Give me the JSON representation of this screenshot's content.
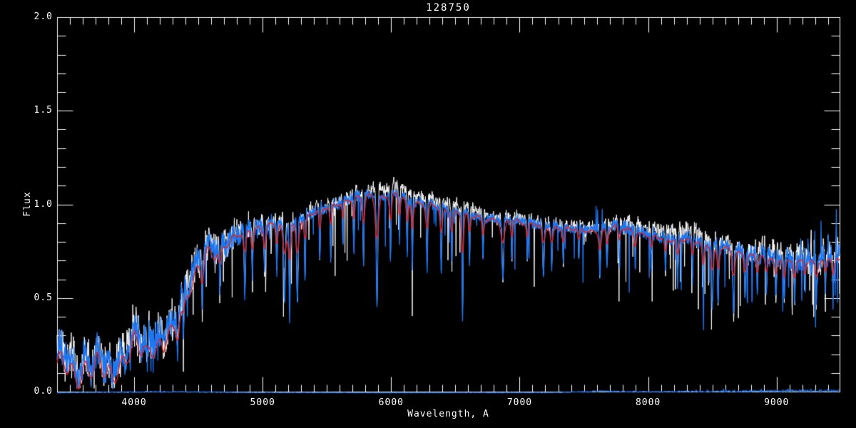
{
  "page": {
    "background": "#000000"
  },
  "chart_data": {
    "type": "line",
    "title": "128750",
    "xlabel": "Wavelength, A",
    "ylabel": "Flux",
    "xlim": [
      3400,
      9490
    ],
    "ylim": [
      0.0,
      2.0
    ],
    "grid": false,
    "legend": null,
    "background": "#000000",
    "axis_color": "#ffffff",
    "x_major_ticks": [
      {
        "value": 4000,
        "label": "4000"
      },
      {
        "value": 5000,
        "label": "5000"
      },
      {
        "value": 6000,
        "label": "6000"
      },
      {
        "value": 7000,
        "label": "7000"
      },
      {
        "value": 8000,
        "label": "8000"
      },
      {
        "value": 9000,
        "label": "9000"
      }
    ],
    "x_minor_step": 100,
    "y_major_ticks": [
      {
        "value": 0.0,
        "label": "0.0"
      },
      {
        "value": 0.5,
        "label": "0.5"
      },
      {
        "value": 1.0,
        "label": "1.0"
      },
      {
        "value": 1.5,
        "label": "1.5"
      },
      {
        "value": 2.0,
        "label": "2.0"
      }
    ],
    "y_minor_step": 0.1,
    "series": [
      {
        "name": "observed-spectrum-white",
        "color": "#ffffff",
        "role": "noisy observed spectrum drawn behind"
      },
      {
        "name": "observed-spectrum-blue",
        "color": "#1d76f2",
        "role": "noisy observed spectrum drawn on top"
      },
      {
        "name": "model-fit-red",
        "color": "#e62222",
        "role": "smooth model spectrum overlay"
      },
      {
        "name": "error-spectrum-blue",
        "color": "#1d76f2",
        "role": "near-zero error array along bottom axis"
      }
    ],
    "continuum_points": [
      [
        3400,
        0.17
      ],
      [
        3460,
        0.2
      ],
      [
        3520,
        0.16
      ],
      [
        3560,
        0.13
      ],
      [
        3620,
        0.17
      ],
      [
        3680,
        0.13
      ],
      [
        3730,
        0.19
      ],
      [
        3780,
        0.14
      ],
      [
        3840,
        0.17
      ],
      [
        3900,
        0.2
      ],
      [
        3950,
        0.28
      ],
      [
        4000,
        0.32
      ],
      [
        4060,
        0.28
      ],
      [
        4120,
        0.32
      ],
      [
        4180,
        0.28
      ],
      [
        4240,
        0.33
      ],
      [
        4300,
        0.32
      ],
      [
        4360,
        0.48
      ],
      [
        4420,
        0.6
      ],
      [
        4470,
        0.66
      ],
      [
        4520,
        0.71
      ],
      [
        4570,
        0.76
      ],
      [
        4620,
        0.74
      ],
      [
        4670,
        0.78
      ],
      [
        4720,
        0.81
      ],
      [
        4800,
        0.84
      ],
      [
        4900,
        0.86
      ],
      [
        5000,
        0.88
      ],
      [
        5100,
        0.9
      ],
      [
        5180,
        0.87
      ],
      [
        5250,
        0.9
      ],
      [
        5350,
        0.94
      ],
      [
        5450,
        0.97
      ],
      [
        5550,
        1.0
      ],
      [
        5650,
        1.02
      ],
      [
        5750,
        1.04
      ],
      [
        5850,
        1.05
      ],
      [
        5950,
        1.04
      ],
      [
        6050,
        1.05
      ],
      [
        6150,
        1.02
      ],
      [
        6250,
        1.0
      ],
      [
        6350,
        0.99
      ],
      [
        6450,
        0.97
      ],
      [
        6550,
        0.95
      ],
      [
        6650,
        0.94
      ],
      [
        6750,
        0.93
      ],
      [
        6850,
        0.91
      ],
      [
        6950,
        0.92
      ],
      [
        7050,
        0.91
      ],
      [
        7150,
        0.89
      ],
      [
        7250,
        0.88
      ],
      [
        7350,
        0.88
      ],
      [
        7450,
        0.87
      ],
      [
        7550,
        0.86
      ],
      [
        7650,
        0.87
      ],
      [
        7750,
        0.88
      ],
      [
        7850,
        0.87
      ],
      [
        7950,
        0.85
      ],
      [
        8050,
        0.83
      ],
      [
        8150,
        0.82
      ],
      [
        8250,
        0.82
      ],
      [
        8350,
        0.81
      ],
      [
        8450,
        0.8
      ],
      [
        8550,
        0.78
      ],
      [
        8650,
        0.76
      ],
      [
        8750,
        0.74
      ],
      [
        8850,
        0.73
      ],
      [
        8950,
        0.72
      ],
      [
        9050,
        0.71
      ],
      [
        9150,
        0.7
      ],
      [
        9250,
        0.7
      ],
      [
        9350,
        0.71
      ],
      [
        9430,
        0.72
      ],
      [
        9490,
        0.7
      ]
    ],
    "band_wiggle_amp_points": [
      [
        3400,
        0.085
      ],
      [
        4300,
        0.075
      ],
      [
        4700,
        0.03
      ],
      [
        5200,
        0.016
      ],
      [
        9490,
        0.012
      ]
    ],
    "absorption_lines": [
      [
        3830,
        7,
        0.45
      ],
      [
        3933,
        7,
        0.5
      ],
      [
        3968,
        7,
        0.45
      ],
      [
        4101,
        7,
        0.45
      ],
      [
        4226,
        6,
        0.45
      ],
      [
        4340,
        7,
        0.5
      ],
      [
        4383,
        6,
        0.45
      ],
      [
        4530,
        6,
        0.38
      ],
      [
        4668,
        6,
        0.32
      ],
      [
        4861,
        7,
        0.4
      ],
      [
        4920,
        5,
        0.3
      ],
      [
        5015,
        5,
        0.3
      ],
      [
        5110,
        5,
        0.32
      ],
      [
        5170,
        8,
        0.45
      ],
      [
        5210,
        6,
        0.55
      ],
      [
        5270,
        7,
        0.48
      ],
      [
        5330,
        5,
        0.35
      ],
      [
        5445,
        5,
        0.3
      ],
      [
        5530,
        5,
        0.28
      ],
      [
        5625,
        4,
        0.25
      ],
      [
        5710,
        5,
        0.3
      ],
      [
        5785,
        5,
        0.35
      ],
      [
        5890,
        8,
        0.55
      ],
      [
        5995,
        5,
        0.35
      ],
      [
        6065,
        4,
        0.25
      ],
      [
        6125,
        5,
        0.3
      ],
      [
        6165,
        5,
        0.35
      ],
      [
        6280,
        6,
        0.35
      ],
      [
        6390,
        6,
        0.35
      ],
      [
        6472,
        5,
        0.3
      ],
      [
        6556,
        5,
        0.58
      ],
      [
        6610,
        5,
        0.3
      ],
      [
        6715,
        5,
        0.25
      ],
      [
        6870,
        9,
        0.35
      ],
      [
        6940,
        5,
        0.25
      ],
      [
        7060,
        5,
        0.22
      ],
      [
        7185,
        8,
        0.3
      ],
      [
        7250,
        6,
        0.25
      ],
      [
        7340,
        5,
        0.22
      ],
      [
        7460,
        5,
        0.2
      ],
      [
        7625,
        6,
        0.3
      ],
      [
        7680,
        5,
        0.25
      ],
      [
        7775,
        5,
        0.2
      ],
      [
        7900,
        5,
        0.22
      ],
      [
        8025,
        5,
        0.22
      ],
      [
        8135,
        5,
        0.25
      ],
      [
        8230,
        6,
        0.3
      ],
      [
        8345,
        5,
        0.28
      ],
      [
        8430,
        6,
        0.4
      ],
      [
        8500,
        7,
        0.45
      ],
      [
        8545,
        6,
        0.4
      ],
      [
        8665,
        7,
        0.45
      ],
      [
        8755,
        6,
        0.32
      ],
      [
        8850,
        5,
        0.3
      ],
      [
        8920,
        6,
        0.32
      ],
      [
        8995,
        6,
        0.35
      ],
      [
        9060,
        5,
        0.32
      ],
      [
        9140,
        6,
        0.32
      ],
      [
        9220,
        5,
        0.28
      ],
      [
        9310,
        6,
        0.32
      ],
      [
        9380,
        5,
        0.28
      ],
      [
        9440,
        5,
        0.32
      ]
    ],
    "emission_spikes": [
      [
        7594,
        3,
        1.13
      ],
      [
        7607,
        6,
        0.99
      ],
      [
        7643,
        5,
        0.96
      ],
      [
        9345,
        4,
        0.92
      ],
      [
        9465,
        4,
        0.97
      ]
    ],
    "noise_amp_points": [
      [
        3400,
        0.105
      ],
      [
        3950,
        0.115
      ],
      [
        4300,
        0.12
      ],
      [
        4700,
        0.085
      ],
      [
        5100,
        0.06
      ],
      [
        5500,
        0.042
      ],
      [
        6600,
        0.035
      ],
      [
        7500,
        0.035
      ],
      [
        7900,
        0.045
      ],
      [
        8700,
        0.052
      ],
      [
        9100,
        0.08
      ],
      [
        9490,
        0.09
      ]
    ],
    "down_spike_prob_points": [
      [
        3400,
        0.02
      ],
      [
        4300,
        0.05
      ],
      [
        5500,
        0.035
      ],
      [
        7000,
        0.028
      ],
      [
        8300,
        0.045
      ],
      [
        9100,
        0.05
      ]
    ],
    "model_scale_points": [
      [
        3400,
        0.7
      ],
      [
        3600,
        0.73
      ],
      [
        3900,
        0.74
      ],
      [
        4100,
        0.82
      ],
      [
        4300,
        0.88
      ],
      [
        4500,
        0.95
      ],
      [
        4700,
        0.985
      ],
      [
        4900,
        1.0
      ],
      [
        9490,
        0.99
      ]
    ],
    "error_level_points": [
      [
        3400,
        0.002
      ],
      [
        3900,
        0.005
      ],
      [
        4150,
        0.007
      ],
      [
        4600,
        0.005
      ],
      [
        5000,
        0.003
      ],
      [
        6000,
        0.002
      ],
      [
        7300,
        0.003
      ],
      [
        7600,
        0.009
      ],
      [
        8000,
        0.007
      ],
      [
        8600,
        0.009
      ],
      [
        9000,
        0.011
      ],
      [
        9490,
        0.014
      ]
    ]
  }
}
